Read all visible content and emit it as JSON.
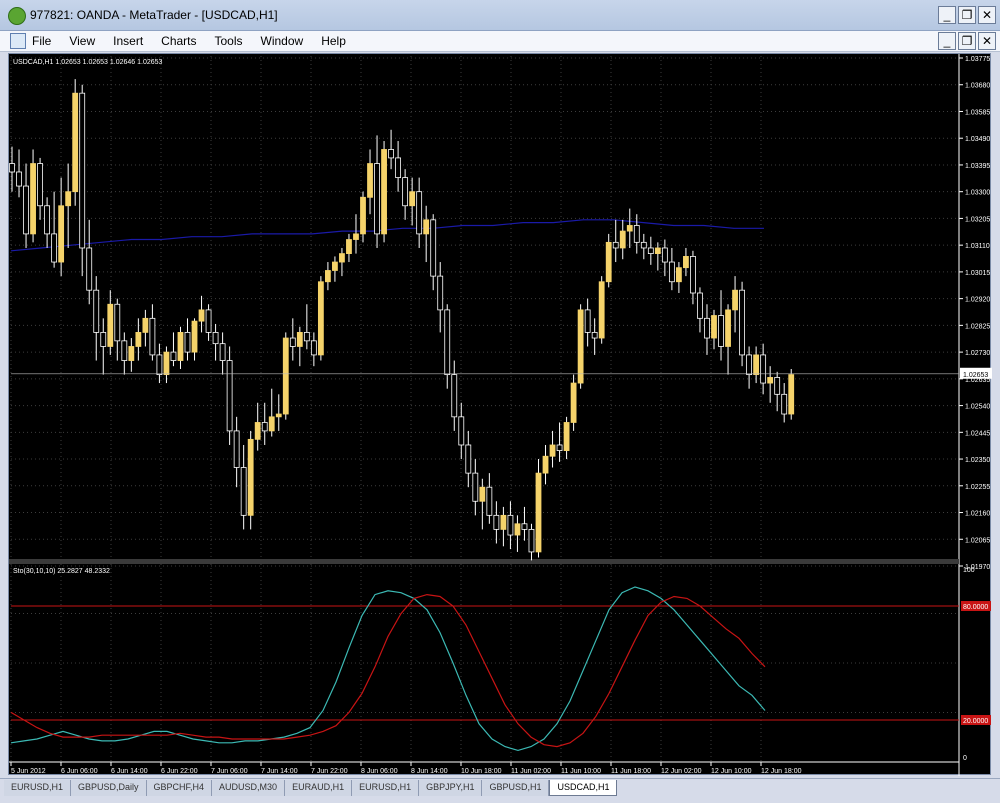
{
  "window": {
    "title": "977821: OANDA - MetaTrader - [USDCAD,H1]"
  },
  "menu": [
    "File",
    "View",
    "Insert",
    "Charts",
    "Tools",
    "Window",
    "Help"
  ],
  "chart": {
    "info": "USDCAD,H1  1.02653 1.02653 1.02646 1.02653",
    "price_ticks": [
      "1.03775",
      "1.03680",
      "1.03585",
      "1.03490",
      "1.03395",
      "1.03300",
      "1.03205",
      "1.03110",
      "1.03015",
      "1.02920",
      "1.02825",
      "1.02730",
      "1.02635",
      "1.02540",
      "1.02445",
      "1.02350",
      "1.02255",
      "1.02160",
      "1.02065",
      "1.01970"
    ],
    "current_price": "1.02653",
    "time_ticks": [
      "5 Jun 2012",
      "6 Jun 06:00",
      "6 Jun 14:00",
      "6 Jun 22:00",
      "7 Jun 06:00",
      "7 Jun 14:00",
      "7 Jun 22:00",
      "8 Jun 06:00",
      "8 Jun 14:00",
      "10 Jun 18:00",
      "11 Jun 02:00",
      "11 Jun 10:00",
      "11 Jun 18:00",
      "12 Jun 02:00",
      "12 Jun 10:00",
      "12 Jun 18:00"
    ]
  },
  "indicator": {
    "info": "Sto(30,10,10) 25.2827 48.2332",
    "ticks": [
      "100",
      "0"
    ],
    "level_high": "80.0000",
    "level_low": "20.0000"
  },
  "colors": {
    "bull": "#f5d36a",
    "bear": "#ffffff",
    "ma": "#1a1aa8",
    "main_line": "#3cb9b4",
    "signal_line": "#c81414",
    "level_line": "#c81414"
  },
  "chart_data": {
    "type": "candlestick",
    "symbol": "USDCAD",
    "timeframe": "H1",
    "ylim": [
      1.0197,
      1.03775
    ],
    "candles": [
      [
        1.034,
        1.0346,
        1.033,
        1.0337
      ],
      [
        1.0337,
        1.0345,
        1.0328,
        1.0332
      ],
      [
        1.0332,
        1.034,
        1.031,
        1.0315
      ],
      [
        1.0315,
        1.0345,
        1.0312,
        1.034
      ],
      [
        1.034,
        1.0342,
        1.032,
        1.0325
      ],
      [
        1.0325,
        1.0328,
        1.031,
        1.0315
      ],
      [
        1.0315,
        1.033,
        1.0303,
        1.0305
      ],
      [
        1.0305,
        1.0335,
        1.03,
        1.0325
      ],
      [
        1.0325,
        1.034,
        1.031,
        1.033
      ],
      [
        1.033,
        1.037,
        1.0325,
        1.0365
      ],
      [
        1.0365,
        1.0368,
        1.03,
        1.031
      ],
      [
        1.031,
        1.032,
        1.029,
        1.0295
      ],
      [
        1.0295,
        1.03,
        1.027,
        1.028
      ],
      [
        1.028,
        1.0285,
        1.0265,
        1.0275
      ],
      [
        1.0275,
        1.0295,
        1.0272,
        1.029
      ],
      [
        1.029,
        1.0292,
        1.027,
        1.0277
      ],
      [
        1.0277,
        1.028,
        1.0265,
        1.027
      ],
      [
        1.027,
        1.0278,
        1.0266,
        1.0275
      ],
      [
        1.0275,
        1.0285,
        1.027,
        1.028
      ],
      [
        1.028,
        1.0288,
        1.0275,
        1.0285
      ],
      [
        1.0285,
        1.029,
        1.027,
        1.0272
      ],
      [
        1.0272,
        1.0276,
        1.0262,
        1.0265
      ],
      [
        1.0265,
        1.0275,
        1.0262,
        1.0273
      ],
      [
        1.0273,
        1.028,
        1.0268,
        1.027
      ],
      [
        1.027,
        1.0282,
        1.0267,
        1.028
      ],
      [
        1.028,
        1.0285,
        1.027,
        1.0273
      ],
      [
        1.0273,
        1.0285,
        1.027,
        1.0284
      ],
      [
        1.0284,
        1.0293,
        1.028,
        1.0288
      ],
      [
        1.0288,
        1.029,
        1.0277,
        1.028
      ],
      [
        1.028,
        1.0283,
        1.027,
        1.0276
      ],
      [
        1.0276,
        1.028,
        1.0265,
        1.027
      ],
      [
        1.027,
        1.0275,
        1.024,
        1.0245
      ],
      [
        1.0245,
        1.025,
        1.0225,
        1.0232
      ],
      [
        1.0232,
        1.024,
        1.021,
        1.0215
      ],
      [
        1.0215,
        1.0245,
        1.021,
        1.0242
      ],
      [
        1.0242,
        1.0255,
        1.0238,
        1.0248
      ],
      [
        1.0248,
        1.0255,
        1.024,
        1.0245
      ],
      [
        1.0245,
        1.026,
        1.0243,
        1.025
      ],
      [
        1.025,
        1.0258,
        1.0245,
        1.0251
      ],
      [
        1.0251,
        1.028,
        1.0249,
        1.0278
      ],
      [
        1.0278,
        1.0285,
        1.027,
        1.0275
      ],
      [
        1.0275,
        1.0282,
        1.0268,
        1.028
      ],
      [
        1.028,
        1.029,
        1.0274,
        1.0277
      ],
      [
        1.0277,
        1.028,
        1.0268,
        1.0272
      ],
      [
        1.0272,
        1.03,
        1.027,
        1.0298
      ],
      [
        1.0298,
        1.0305,
        1.0295,
        1.0302
      ],
      [
        1.0302,
        1.0307,
        1.0298,
        1.0305
      ],
      [
        1.0305,
        1.031,
        1.03,
        1.0308
      ],
      [
        1.0308,
        1.0315,
        1.0305,
        1.0313
      ],
      [
        1.0313,
        1.0322,
        1.0308,
        1.0315
      ],
      [
        1.0315,
        1.033,
        1.0312,
        1.0328
      ],
      [
        1.0328,
        1.0345,
        1.0322,
        1.034
      ],
      [
        1.034,
        1.035,
        1.031,
        1.0315
      ],
      [
        1.0315,
        1.0348,
        1.0312,
        1.0345
      ],
      [
        1.0345,
        1.0352,
        1.0338,
        1.0342
      ],
      [
        1.0342,
        1.0348,
        1.033,
        1.0335
      ],
      [
        1.0335,
        1.0338,
        1.032,
        1.0325
      ],
      [
        1.0325,
        1.0335,
        1.0318,
        1.033
      ],
      [
        1.033,
        1.0335,
        1.031,
        1.0315
      ],
      [
        1.0315,
        1.0325,
        1.0305,
        1.032
      ],
      [
        1.032,
        1.0322,
        1.0295,
        1.03
      ],
      [
        1.03,
        1.0305,
        1.028,
        1.0288
      ],
      [
        1.0288,
        1.029,
        1.026,
        1.0265
      ],
      [
        1.0265,
        1.027,
        1.0245,
        1.025
      ],
      [
        1.025,
        1.0255,
        1.0235,
        1.024
      ],
      [
        1.024,
        1.0245,
        1.0225,
        1.023
      ],
      [
        1.023,
        1.0235,
        1.0215,
        1.022
      ],
      [
        1.022,
        1.0228,
        1.021,
        1.0225
      ],
      [
        1.0225,
        1.023,
        1.0212,
        1.0215
      ],
      [
        1.0215,
        1.022,
        1.0205,
        1.021
      ],
      [
        1.021,
        1.0218,
        1.0204,
        1.0215
      ],
      [
        1.0215,
        1.022,
        1.0203,
        1.0208
      ],
      [
        1.0208,
        1.0215,
        1.0202,
        1.0212
      ],
      [
        1.0212,
        1.0218,
        1.0206,
        1.021
      ],
      [
        1.021,
        1.0212,
        1.0199,
        1.0202
      ],
      [
        1.0202,
        1.0235,
        1.02,
        1.023
      ],
      [
        1.023,
        1.024,
        1.0226,
        1.0236
      ],
      [
        1.0236,
        1.0245,
        1.0232,
        1.024
      ],
      [
        1.024,
        1.0248,
        1.0234,
        1.0238
      ],
      [
        1.0238,
        1.025,
        1.0235,
        1.0248
      ],
      [
        1.0248,
        1.0265,
        1.0245,
        1.0262
      ],
      [
        1.0262,
        1.029,
        1.026,
        1.0288
      ],
      [
        1.0288,
        1.0292,
        1.0275,
        1.028
      ],
      [
        1.028,
        1.0285,
        1.0272,
        1.0278
      ],
      [
        1.0278,
        1.03,
        1.0276,
        1.0298
      ],
      [
        1.0298,
        1.0315,
        1.0296,
        1.0312
      ],
      [
        1.0312,
        1.032,
        1.0305,
        1.031
      ],
      [
        1.031,
        1.032,
        1.0306,
        1.0316
      ],
      [
        1.0316,
        1.0324,
        1.031,
        1.0318
      ],
      [
        1.0318,
        1.0322,
        1.0308,
        1.0312
      ],
      [
        1.0312,
        1.0315,
        1.0306,
        1.031
      ],
      [
        1.031,
        1.0314,
        1.0304,
        1.0308
      ],
      [
        1.0308,
        1.0312,
        1.0302,
        1.031
      ],
      [
        1.031,
        1.0313,
        1.03,
        1.0305
      ],
      [
        1.0305,
        1.031,
        1.0295,
        1.0298
      ],
      [
        1.0298,
        1.0305,
        1.0294,
        1.0303
      ],
      [
        1.0303,
        1.031,
        1.03,
        1.0307
      ],
      [
        1.0307,
        1.0309,
        1.029,
        1.0294
      ],
      [
        1.0294,
        1.0296,
        1.028,
        1.0285
      ],
      [
        1.0285,
        1.029,
        1.0272,
        1.0278
      ],
      [
        1.0278,
        1.0288,
        1.0274,
        1.0286
      ],
      [
        1.0286,
        1.0295,
        1.027,
        1.0275
      ],
      [
        1.0275,
        1.029,
        1.0265,
        1.0288
      ],
      [
        1.0288,
        1.03,
        1.028,
        1.0295
      ],
      [
        1.0295,
        1.0298,
        1.0268,
        1.0272
      ],
      [
        1.0272,
        1.0275,
        1.026,
        1.0265
      ],
      [
        1.0265,
        1.0275,
        1.0262,
        1.0272
      ],
      [
        1.0272,
        1.0276,
        1.0258,
        1.0262
      ],
      [
        1.0262,
        1.0268,
        1.0255,
        1.0264
      ],
      [
        1.0264,
        1.0266,
        1.0252,
        1.0258
      ],
      [
        1.0258,
        1.0262,
        1.0248,
        1.0251
      ],
      [
        1.0251,
        1.0267,
        1.0249,
        1.0265
      ]
    ],
    "series": [
      {
        "values": [
          1.0309,
          1.031,
          1.0311,
          1.0312,
          1.0313,
          1.0313,
          1.0314,
          1.0314,
          1.0315,
          1.0315,
          1.0315,
          1.0316,
          1.0316,
          1.0317,
          1.0317,
          1.0318,
          1.0318,
          1.0319,
          1.0319,
          1.032,
          1.032,
          1.0319,
          1.0318,
          1.0318,
          1.0317,
          1.0317
        ]
      },
      {
        "values": [
          8,
          9,
          10,
          12,
          14,
          12,
          10,
          9,
          9,
          10,
          12,
          14,
          14,
          12,
          10,
          9,
          8,
          8,
          9,
          9,
          10,
          11,
          13,
          16,
          25,
          40,
          58,
          75,
          86,
          88,
          87,
          84,
          78,
          66,
          50,
          33,
          18,
          10,
          6,
          4,
          6,
          10,
          18,
          30,
          46,
          62,
          78,
          87,
          90,
          88,
          84,
          78,
          70,
          62,
          54,
          46,
          38,
          33,
          25
        ]
      },
      {
        "values": [
          24,
          20,
          16,
          13,
          11,
          11,
          11,
          12,
          12,
          12,
          12,
          12,
          12,
          13,
          12,
          11,
          11,
          10,
          10,
          10,
          10,
          10,
          11,
          12,
          14,
          17,
          24,
          34,
          48,
          64,
          76,
          84,
          86,
          85,
          80,
          70,
          56,
          42,
          28,
          18,
          11,
          7,
          6,
          8,
          13,
          22,
          34,
          48,
          62,
          75,
          82,
          85,
          84,
          80,
          74,
          68,
          63,
          55,
          48
        ]
      }
    ]
  }
}
